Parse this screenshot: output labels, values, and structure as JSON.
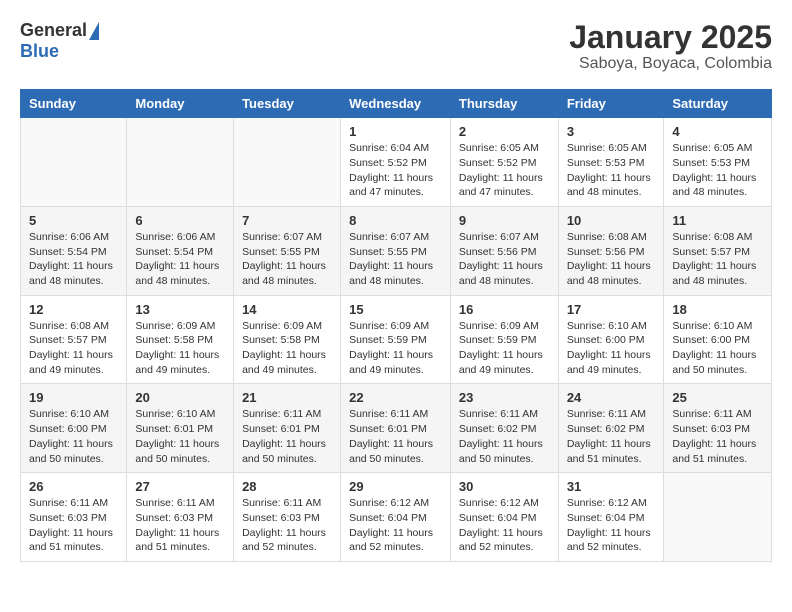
{
  "logo": {
    "general": "General",
    "blue": "Blue"
  },
  "title": "January 2025",
  "subtitle": "Saboya, Boyaca, Colombia",
  "days_of_week": [
    "Sunday",
    "Monday",
    "Tuesday",
    "Wednesday",
    "Thursday",
    "Friday",
    "Saturday"
  ],
  "weeks": [
    [
      {
        "day": "",
        "info": ""
      },
      {
        "day": "",
        "info": ""
      },
      {
        "day": "",
        "info": ""
      },
      {
        "day": "1",
        "info": "Sunrise: 6:04 AM\nSunset: 5:52 PM\nDaylight: 11 hours and 47 minutes."
      },
      {
        "day": "2",
        "info": "Sunrise: 6:05 AM\nSunset: 5:52 PM\nDaylight: 11 hours and 47 minutes."
      },
      {
        "day": "3",
        "info": "Sunrise: 6:05 AM\nSunset: 5:53 PM\nDaylight: 11 hours and 48 minutes."
      },
      {
        "day": "4",
        "info": "Sunrise: 6:05 AM\nSunset: 5:53 PM\nDaylight: 11 hours and 48 minutes."
      }
    ],
    [
      {
        "day": "5",
        "info": "Sunrise: 6:06 AM\nSunset: 5:54 PM\nDaylight: 11 hours and 48 minutes."
      },
      {
        "day": "6",
        "info": "Sunrise: 6:06 AM\nSunset: 5:54 PM\nDaylight: 11 hours and 48 minutes."
      },
      {
        "day": "7",
        "info": "Sunrise: 6:07 AM\nSunset: 5:55 PM\nDaylight: 11 hours and 48 minutes."
      },
      {
        "day": "8",
        "info": "Sunrise: 6:07 AM\nSunset: 5:55 PM\nDaylight: 11 hours and 48 minutes."
      },
      {
        "day": "9",
        "info": "Sunrise: 6:07 AM\nSunset: 5:56 PM\nDaylight: 11 hours and 48 minutes."
      },
      {
        "day": "10",
        "info": "Sunrise: 6:08 AM\nSunset: 5:56 PM\nDaylight: 11 hours and 48 minutes."
      },
      {
        "day": "11",
        "info": "Sunrise: 6:08 AM\nSunset: 5:57 PM\nDaylight: 11 hours and 48 minutes."
      }
    ],
    [
      {
        "day": "12",
        "info": "Sunrise: 6:08 AM\nSunset: 5:57 PM\nDaylight: 11 hours and 49 minutes."
      },
      {
        "day": "13",
        "info": "Sunrise: 6:09 AM\nSunset: 5:58 PM\nDaylight: 11 hours and 49 minutes."
      },
      {
        "day": "14",
        "info": "Sunrise: 6:09 AM\nSunset: 5:58 PM\nDaylight: 11 hours and 49 minutes."
      },
      {
        "day": "15",
        "info": "Sunrise: 6:09 AM\nSunset: 5:59 PM\nDaylight: 11 hours and 49 minutes."
      },
      {
        "day": "16",
        "info": "Sunrise: 6:09 AM\nSunset: 5:59 PM\nDaylight: 11 hours and 49 minutes."
      },
      {
        "day": "17",
        "info": "Sunrise: 6:10 AM\nSunset: 6:00 PM\nDaylight: 11 hours and 49 minutes."
      },
      {
        "day": "18",
        "info": "Sunrise: 6:10 AM\nSunset: 6:00 PM\nDaylight: 11 hours and 50 minutes."
      }
    ],
    [
      {
        "day": "19",
        "info": "Sunrise: 6:10 AM\nSunset: 6:00 PM\nDaylight: 11 hours and 50 minutes."
      },
      {
        "day": "20",
        "info": "Sunrise: 6:10 AM\nSunset: 6:01 PM\nDaylight: 11 hours and 50 minutes."
      },
      {
        "day": "21",
        "info": "Sunrise: 6:11 AM\nSunset: 6:01 PM\nDaylight: 11 hours and 50 minutes."
      },
      {
        "day": "22",
        "info": "Sunrise: 6:11 AM\nSunset: 6:01 PM\nDaylight: 11 hours and 50 minutes."
      },
      {
        "day": "23",
        "info": "Sunrise: 6:11 AM\nSunset: 6:02 PM\nDaylight: 11 hours and 50 minutes."
      },
      {
        "day": "24",
        "info": "Sunrise: 6:11 AM\nSunset: 6:02 PM\nDaylight: 11 hours and 51 minutes."
      },
      {
        "day": "25",
        "info": "Sunrise: 6:11 AM\nSunset: 6:03 PM\nDaylight: 11 hours and 51 minutes."
      }
    ],
    [
      {
        "day": "26",
        "info": "Sunrise: 6:11 AM\nSunset: 6:03 PM\nDaylight: 11 hours and 51 minutes."
      },
      {
        "day": "27",
        "info": "Sunrise: 6:11 AM\nSunset: 6:03 PM\nDaylight: 11 hours and 51 minutes."
      },
      {
        "day": "28",
        "info": "Sunrise: 6:11 AM\nSunset: 6:03 PM\nDaylight: 11 hours and 52 minutes."
      },
      {
        "day": "29",
        "info": "Sunrise: 6:12 AM\nSunset: 6:04 PM\nDaylight: 11 hours and 52 minutes."
      },
      {
        "day": "30",
        "info": "Sunrise: 6:12 AM\nSunset: 6:04 PM\nDaylight: 11 hours and 52 minutes."
      },
      {
        "day": "31",
        "info": "Sunrise: 6:12 AM\nSunset: 6:04 PM\nDaylight: 11 hours and 52 minutes."
      },
      {
        "day": "",
        "info": ""
      }
    ]
  ]
}
